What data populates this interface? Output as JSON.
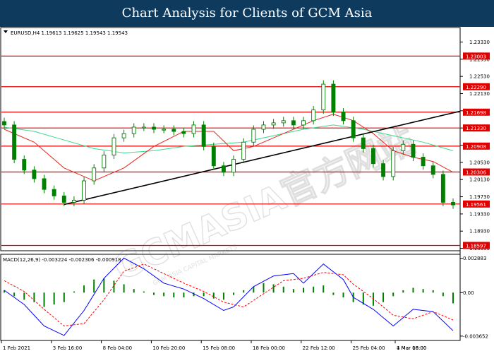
{
  "banner": {
    "title": "Chart Analysis for Clients of GCM Asia"
  },
  "watermark": {
    "brand": "GCMASIA官方网站",
    "small": "GCM ASIA CAPITAL MARKETS"
  },
  "colors": {
    "banner_bg": "#0e3a5e",
    "candle": "#008000",
    "level_line": "#e00000",
    "level_box": "#e00000",
    "ma_fast": "#e8241c",
    "ma_slow": "#3cd98c",
    "trendline": "#000000",
    "macd_line": "#0000ff",
    "signal_line": "#ff0000",
    "histogram": "#008000"
  },
  "chart_data": [
    {
      "type": "candlestick",
      "title": "EURUSD,H4  1.19613 1.19625 1.19543 1.19543",
      "symbol": "EURUSD",
      "timeframe": "H4",
      "ohlc_last": [
        "1.19613",
        "1.19625",
        "1.19543",
        "1.19543"
      ],
      "ylim": [
        1.1849,
        1.2365
      ],
      "y_ticks": [
        "1.23330",
        "1.22930",
        "1.22530",
        "1.22130",
        "1.21730",
        "1.21330",
        "1.20930",
        "1.20530",
        "1.20130",
        "1.19730",
        "1.19330",
        "1.18930",
        "1.18530"
      ],
      "levels": [
        "1.23003",
        "1.22290",
        "1.21698",
        "1.21330",
        "1.20908",
        "1.20306",
        "1.19561",
        "1.18597"
      ],
      "x_ticks": [
        "1 Feb 2021",
        "3 Feb 16:00",
        "8 Feb 04:00",
        "10 Feb 20:00",
        "15 Feb 08:00",
        "18 Feb 00:00",
        "22 Feb 12:00",
        "25 Feb 04:00",
        "1 Mar 16:00",
        "4 Mar 08:00"
      ],
      "trendline": {
        "from_price": 1.1955,
        "to_price": 1.2172
      },
      "close_points": [
        [
          0,
          1.214
        ],
        [
          1,
          1.206
        ],
        [
          2,
          1.2035
        ],
        [
          3,
          1.2015
        ],
        [
          4,
          1.199
        ],
        [
          5,
          1.1975
        ],
        [
          6,
          1.196
        ],
        [
          7,
          1.1965
        ],
        [
          8,
          1.201
        ],
        [
          9,
          1.204
        ],
        [
          10,
          1.207
        ],
        [
          11,
          1.211
        ],
        [
          12,
          1.212
        ],
        [
          13,
          1.2135
        ],
        [
          14,
          1.2135
        ],
        [
          15,
          1.213
        ],
        [
          16,
          1.213
        ],
        [
          17,
          1.2125
        ],
        [
          18,
          1.212
        ],
        [
          19,
          1.214
        ],
        [
          20,
          1.209
        ],
        [
          21,
          1.2045
        ],
        [
          22,
          1.203
        ],
        [
          23,
          1.206
        ],
        [
          24,
          1.21
        ],
        [
          25,
          1.213
        ],
        [
          26,
          1.214
        ],
        [
          27,
          1.2145
        ],
        [
          28,
          1.215
        ],
        [
          29,
          1.214
        ],
        [
          30,
          1.215
        ],
        [
          31,
          1.2175
        ],
        [
          32,
          1.2235
        ],
        [
          33,
          1.217
        ],
        [
          34,
          1.215
        ],
        [
          35,
          1.211
        ],
        [
          36,
          1.2085
        ],
        [
          37,
          1.205
        ],
        [
          38,
          1.202
        ],
        [
          39,
          1.208
        ],
        [
          40,
          1.2095
        ],
        [
          41,
          1.2065
        ],
        [
          42,
          1.2045
        ],
        [
          43,
          1.2025
        ],
        [
          44,
          1.196
        ],
        [
          45,
          1.1954
        ]
      ],
      "ma_fast_points": [
        [
          0,
          1.213
        ],
        [
          3,
          1.21
        ],
        [
          6,
          1.204
        ],
        [
          9,
          1.201
        ],
        [
          12,
          1.204
        ],
        [
          15,
          1.209
        ],
        [
          18,
          1.2125
        ],
        [
          21,
          1.2125
        ],
        [
          23,
          1.208
        ],
        [
          25,
          1.209
        ],
        [
          28,
          1.212
        ],
        [
          31,
          1.215
        ],
        [
          33,
          1.2165
        ],
        [
          35,
          1.215
        ],
        [
          37,
          1.212
        ],
        [
          39,
          1.208
        ],
        [
          41,
          1.2065
        ],
        [
          43,
          1.2055
        ],
        [
          45,
          1.203
        ]
      ],
      "ma_slow_points": [
        [
          0,
          1.2135
        ],
        [
          3,
          1.2125
        ],
        [
          6,
          1.2105
        ],
        [
          9,
          1.2085
        ],
        [
          12,
          1.2075
        ],
        [
          15,
          1.208
        ],
        [
          18,
          1.209
        ],
        [
          21,
          1.2095
        ],
        [
          24,
          1.21
        ],
        [
          27,
          1.2115
        ],
        [
          30,
          1.213
        ],
        [
          33,
          1.214
        ],
        [
          36,
          1.213
        ],
        [
          39,
          1.2115
        ],
        [
          42,
          1.21
        ],
        [
          45,
          1.208
        ]
      ]
    },
    {
      "type": "line",
      "title": "MACD(12,26,9) -0.003224 -0.002306 -0.000918",
      "params": "MACD(12,26,9)",
      "values_shown": [
        "-0.003224",
        "-0.002306",
        "-0.000918"
      ],
      "ylim": [
        -0.0039,
        0.0031
      ],
      "y_ticks": [
        "0.002883",
        "0.00",
        "-0.003652"
      ],
      "series": [
        {
          "name": "MACD",
          "points": [
            [
              0,
              0.0002
            ],
            [
              2,
              -0.001
            ],
            [
              4,
              -0.0028
            ],
            [
              6,
              -0.0036
            ],
            [
              8,
              -0.0015
            ],
            [
              10,
              0.0012
            ],
            [
              12,
              0.0029
            ],
            [
              14,
              0.002
            ],
            [
              16,
              0.0008
            ],
            [
              18,
              0.0003
            ],
            [
              20,
              -0.0005
            ],
            [
              22,
              -0.0015
            ],
            [
              23,
              -0.0012
            ],
            [
              25,
              0.0005
            ],
            [
              27,
              0.0014
            ],
            [
              29,
              0.0016
            ],
            [
              30,
              0.0008
            ],
            [
              32,
              0.0024
            ],
            [
              34,
              0.0011
            ],
            [
              35,
              -0.0004
            ],
            [
              37,
              -0.0014
            ],
            [
              39,
              -0.0028
            ],
            [
              41,
              -0.0014
            ],
            [
              43,
              -0.0016
            ],
            [
              45,
              -0.0032
            ]
          ]
        },
        {
          "name": "Signal",
          "points": [
            [
              0,
              0.001
            ],
            [
              2,
              0.0001
            ],
            [
              4,
              -0.0014
            ],
            [
              6,
              -0.0028
            ],
            [
              8,
              -0.0026
            ],
            [
              10,
              -0.0006
            ],
            [
              12,
              0.0018
            ],
            [
              14,
              0.0024
            ],
            [
              16,
              0.0016
            ],
            [
              18,
              0.0008
            ],
            [
              20,
              0.0001
            ],
            [
              22,
              -0.0008
            ],
            [
              24,
              -0.0012
            ],
            [
              26,
              -0.0001
            ],
            [
              28,
              0.001
            ],
            [
              30,
              0.0012
            ],
            [
              32,
              0.0017
            ],
            [
              34,
              0.0015
            ],
            [
              35,
              0.0007
            ],
            [
              37,
              -0.0005
            ],
            [
              39,
              -0.0019
            ],
            [
              41,
              -0.0022
            ],
            [
              43,
              -0.0016
            ],
            [
              45,
              -0.0023
            ]
          ]
        }
      ],
      "histogram": [
        0.0002,
        -0.0003,
        -0.0006,
        -0.0008,
        -0.0012,
        -0.001,
        -0.0008,
        0.0001,
        0.0006,
        0.0011,
        0.0012,
        0.001,
        0.0007,
        0.0003,
        0.0001,
        -0.0002,
        -0.0003,
        -0.0004,
        -0.0004,
        -0.0003,
        -0.0003,
        -0.0005,
        -0.0006,
        -0.0002,
        0.0002,
        0.0005,
        0.0008,
        0.0007,
        0.0005,
        0.0003,
        0.0004,
        0.0005,
        0.0006,
        -0.0002,
        -0.0004,
        -0.0008,
        -0.001,
        -0.0011,
        -0.0008,
        -0.0003,
        0.0002,
        0.0004,
        0.0003,
        0.0002,
        -0.0003,
        -0.0009
      ]
    }
  ]
}
